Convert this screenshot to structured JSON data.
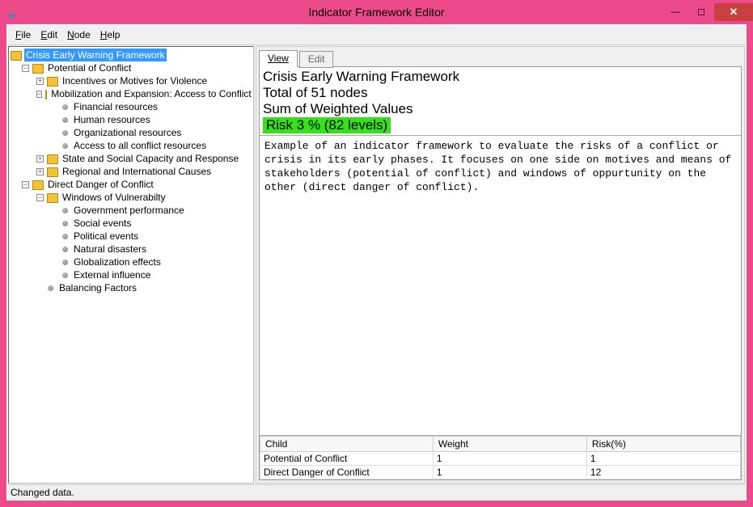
{
  "window": {
    "title": "Indicator Framework Editor"
  },
  "menu": {
    "file": "File",
    "edit": "Edit",
    "node": "Node",
    "help": "Help"
  },
  "tree": {
    "root": "Crisis Early Warning Framework",
    "n_potential": "Potential of Conflict",
    "n_incentives": "Incentives or Motives for Violence",
    "n_mobilization": "Mobilization and Expansion: Access to Conflict Resources",
    "n_financial": "Financial resources",
    "n_human": "Human resources",
    "n_org": "Organizational resources",
    "n_access_all": "Access to all conflict resources",
    "n_state": "State and Social Capacity and Response",
    "n_regional": "Regional and International Causes",
    "n_direct": "Direct Danger of Conflict",
    "n_windows": "Windows of Vulnerabilty",
    "n_gov": "Government performance",
    "n_social": "Social events",
    "n_political": "Political  events",
    "n_natural": "Natural disasters",
    "n_global": "Globalization effects",
    "n_external": "External influence",
    "n_balancing": "Balancing Factors"
  },
  "tabs": {
    "view": "View",
    "edit": "Edit"
  },
  "summary": {
    "title": "Crisis Early Warning Framework",
    "total": "Total of 51 nodes",
    "sum": "Sum of Weighted Values",
    "risk": "Risk 3 % (82 levels)"
  },
  "description": "Example of an indicator framework to evaluate the risks of a conflict or crisis in its early phases. It focuses on one side on motives and means of stakeholders (potential of conflict) and windows of oppurtunity on the other (direct danger of conflict).",
  "table": {
    "headers": {
      "c0": "Child",
      "c1": "Weight",
      "c2": "Risk(%)"
    },
    "r0": {
      "c0": "Potential of Conflict",
      "c1": "1",
      "c2": "1"
    },
    "r1": {
      "c0": "Direct Danger of Conflict",
      "c1": "1",
      "c2": "12"
    }
  },
  "status": "Changed data."
}
